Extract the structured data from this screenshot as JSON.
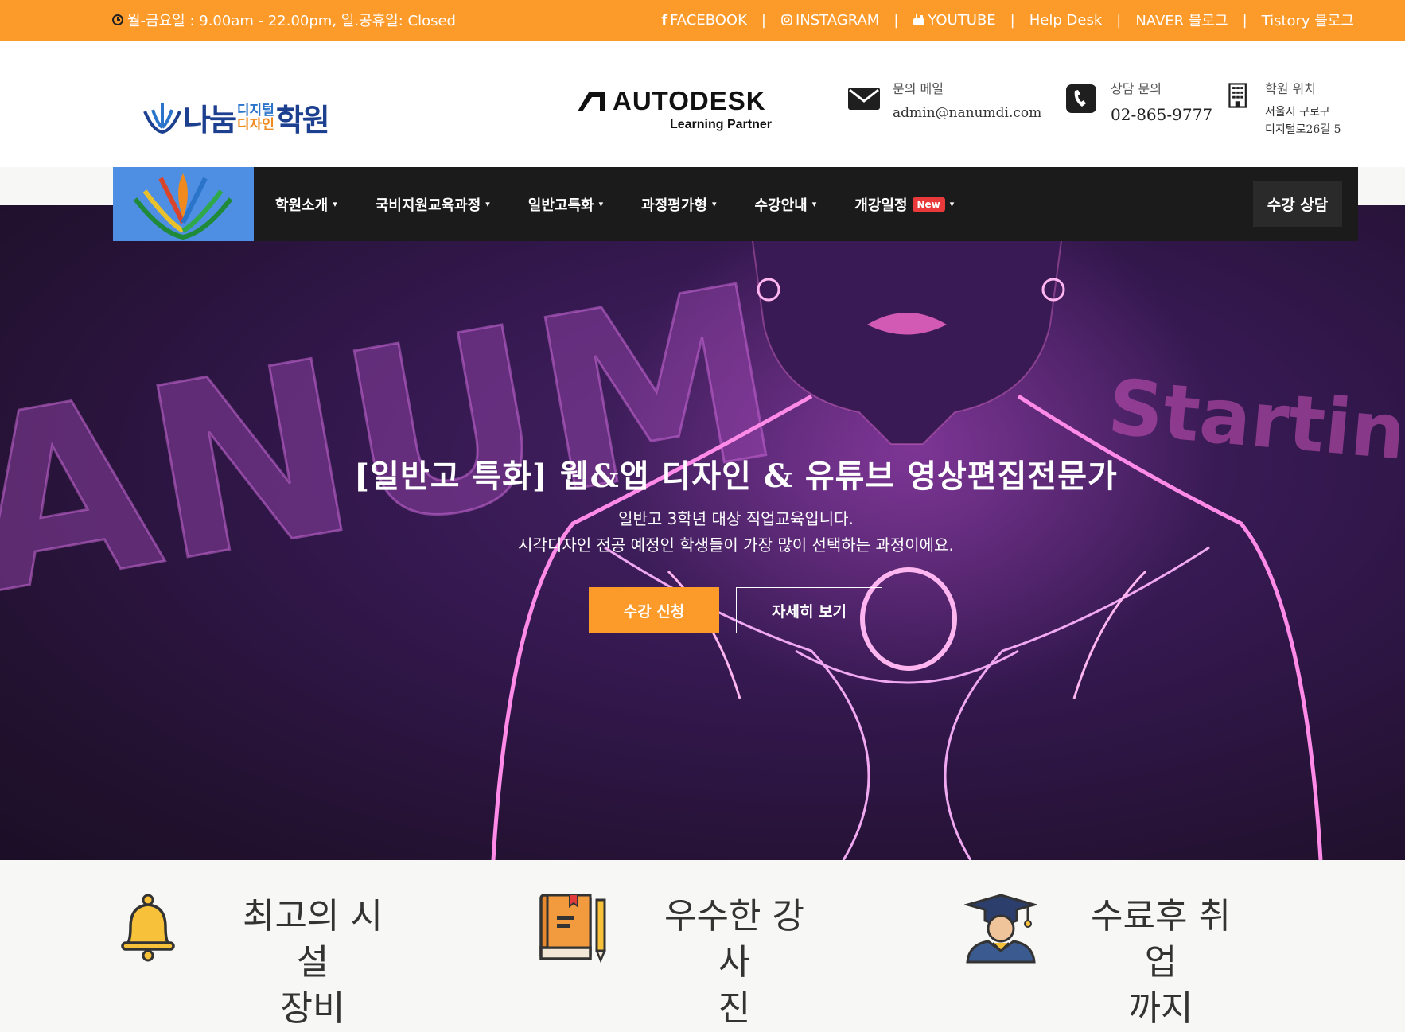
{
  "topbar": {
    "hours": "월-금요일 : 9.00am - 22.00pm, 일.공휴일: Closed",
    "links": [
      {
        "label": "FACEBOOK",
        "icon": "facebook-icon"
      },
      {
        "label": "INSTAGRAM",
        "icon": "instagram-icon"
      },
      {
        "label": "YOUTUBE",
        "icon": "youtube-icon"
      },
      {
        "label": "Help Desk",
        "icon": ""
      },
      {
        "label": "NAVER 블로그",
        "icon": ""
      },
      {
        "label": "Tistory 블로그",
        "icon": ""
      }
    ],
    "separator": "|"
  },
  "header": {
    "logo": {
      "part1": "나눔",
      "stack_top": "디지털",
      "stack_bottom": "디자인",
      "part2": "학원"
    },
    "partner": {
      "brand": "AUTODESK",
      "sub": "Learning Partner"
    },
    "mail": {
      "label": "문의 메일",
      "value": "admin@nanumdi.com"
    },
    "phone": {
      "label": "상담 문의",
      "value": "02-865-9777"
    },
    "location": {
      "label": "학원 위치",
      "line1": "서울시 구로구",
      "line2": "디지털로26길 5"
    }
  },
  "nav": {
    "items": [
      {
        "label": "학원소개"
      },
      {
        "label": "국비지원교육과정"
      },
      {
        "label": "일반고특화"
      },
      {
        "label": "과정평가형"
      },
      {
        "label": "수강안내"
      },
      {
        "label": "개강일정",
        "badge": "New"
      }
    ],
    "cta": "수강 상담"
  },
  "hero": {
    "title": "[일반고 특화] 웹&앱 디자인 & 유튜브 영상편집전문가",
    "subtitle1": "일반고 3학년 대상 직업교육입니다.",
    "subtitle2": "시각디자인 전공 예정인 학생들이 가장 많이 선택하는 과정이에요.",
    "primary_button": "수강 신청",
    "secondary_button": "자세히 보기",
    "bg_text_left": "ANUM",
    "bg_text_right": "Starting"
  },
  "features": [
    {
      "line1": "최고의 시설",
      "line2": "장비",
      "icon": "bell-icon"
    },
    {
      "line1": "우수한 강사",
      "line2": "진",
      "icon": "book-pencil-icon"
    },
    {
      "line1": "수료후 취업",
      "line2": "까지",
      "icon": "graduate-icon"
    }
  ],
  "colors": {
    "accent": "#fc9a2a",
    "nav_bg": "#1b1b1b",
    "logo_blue": "#1c3f8f",
    "badge_red": "#e83a3a"
  }
}
